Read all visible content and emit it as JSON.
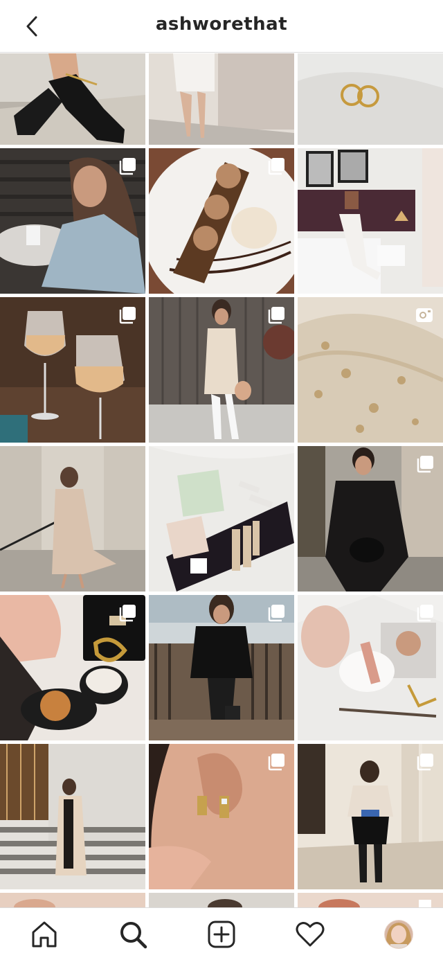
{
  "header": {
    "title": "ashworethat",
    "back_icon": "chevron-left-icon"
  },
  "grid": {
    "columns": 3,
    "posts": [
      {
        "id": "heels-anklet",
        "type": "photo",
        "badge": ""
      },
      {
        "id": "white-shirt-dress-brick-wall",
        "type": "photo",
        "badge": ""
      },
      {
        "id": "gold-earrings-on-satin",
        "type": "photo",
        "badge": ""
      },
      {
        "id": "coffee-denim-jacket",
        "type": "carousel",
        "badge": "carousel-icon"
      },
      {
        "id": "dessert-plate",
        "type": "carousel",
        "badge": "carousel-icon"
      },
      {
        "id": "bedroom-reading-magazine",
        "type": "photo",
        "badge": ""
      },
      {
        "id": "rose-wine-glasses",
        "type": "carousel",
        "badge": "carousel-icon"
      },
      {
        "id": "cream-shirt-dress-white-boots",
        "type": "carousel",
        "badge": "carousel-icon"
      },
      {
        "id": "embroidered-tulle-fabric",
        "type": "video",
        "badge": "video-camera-icon"
      },
      {
        "id": "beige-trench-coat-columns",
        "type": "photo",
        "badge": ""
      },
      {
        "id": "beauty-products-flatlay",
        "type": "photo",
        "badge": ""
      },
      {
        "id": "black-blazer-street",
        "type": "carousel",
        "badge": "carousel-icon"
      },
      {
        "id": "prada-bag-coffee-flatlay",
        "type": "carousel",
        "badge": "carousel-icon"
      },
      {
        "id": "black-dress-balcony",
        "type": "carousel",
        "badge": "carousel-icon"
      },
      {
        "id": "magazine-makeup-flatlay",
        "type": "carousel",
        "badge": "carousel-icon"
      },
      {
        "id": "trench-coat-stairs",
        "type": "photo",
        "badge": ""
      },
      {
        "id": "earrings-closeup",
        "type": "carousel",
        "badge": "carousel-icon"
      },
      {
        "id": "knee-boots-arcade",
        "type": "carousel",
        "badge": "carousel-icon"
      },
      {
        "id": "partial-row-1",
        "type": "photo",
        "badge": ""
      },
      {
        "id": "partial-row-2",
        "type": "photo",
        "badge": ""
      },
      {
        "id": "partial-row-3",
        "type": "photo",
        "badge": "carousel-icon"
      }
    ]
  },
  "nav": {
    "items": [
      {
        "name": "home",
        "icon": "home-icon"
      },
      {
        "name": "search",
        "icon": "search-icon",
        "active": true
      },
      {
        "name": "new-post",
        "icon": "plus-square-icon"
      },
      {
        "name": "activity",
        "icon": "heart-icon"
      },
      {
        "name": "profile",
        "icon": "avatar"
      }
    ]
  },
  "colors": {
    "border": "#dbdbdb",
    "text": "#262626",
    "background": "#ffffff"
  }
}
